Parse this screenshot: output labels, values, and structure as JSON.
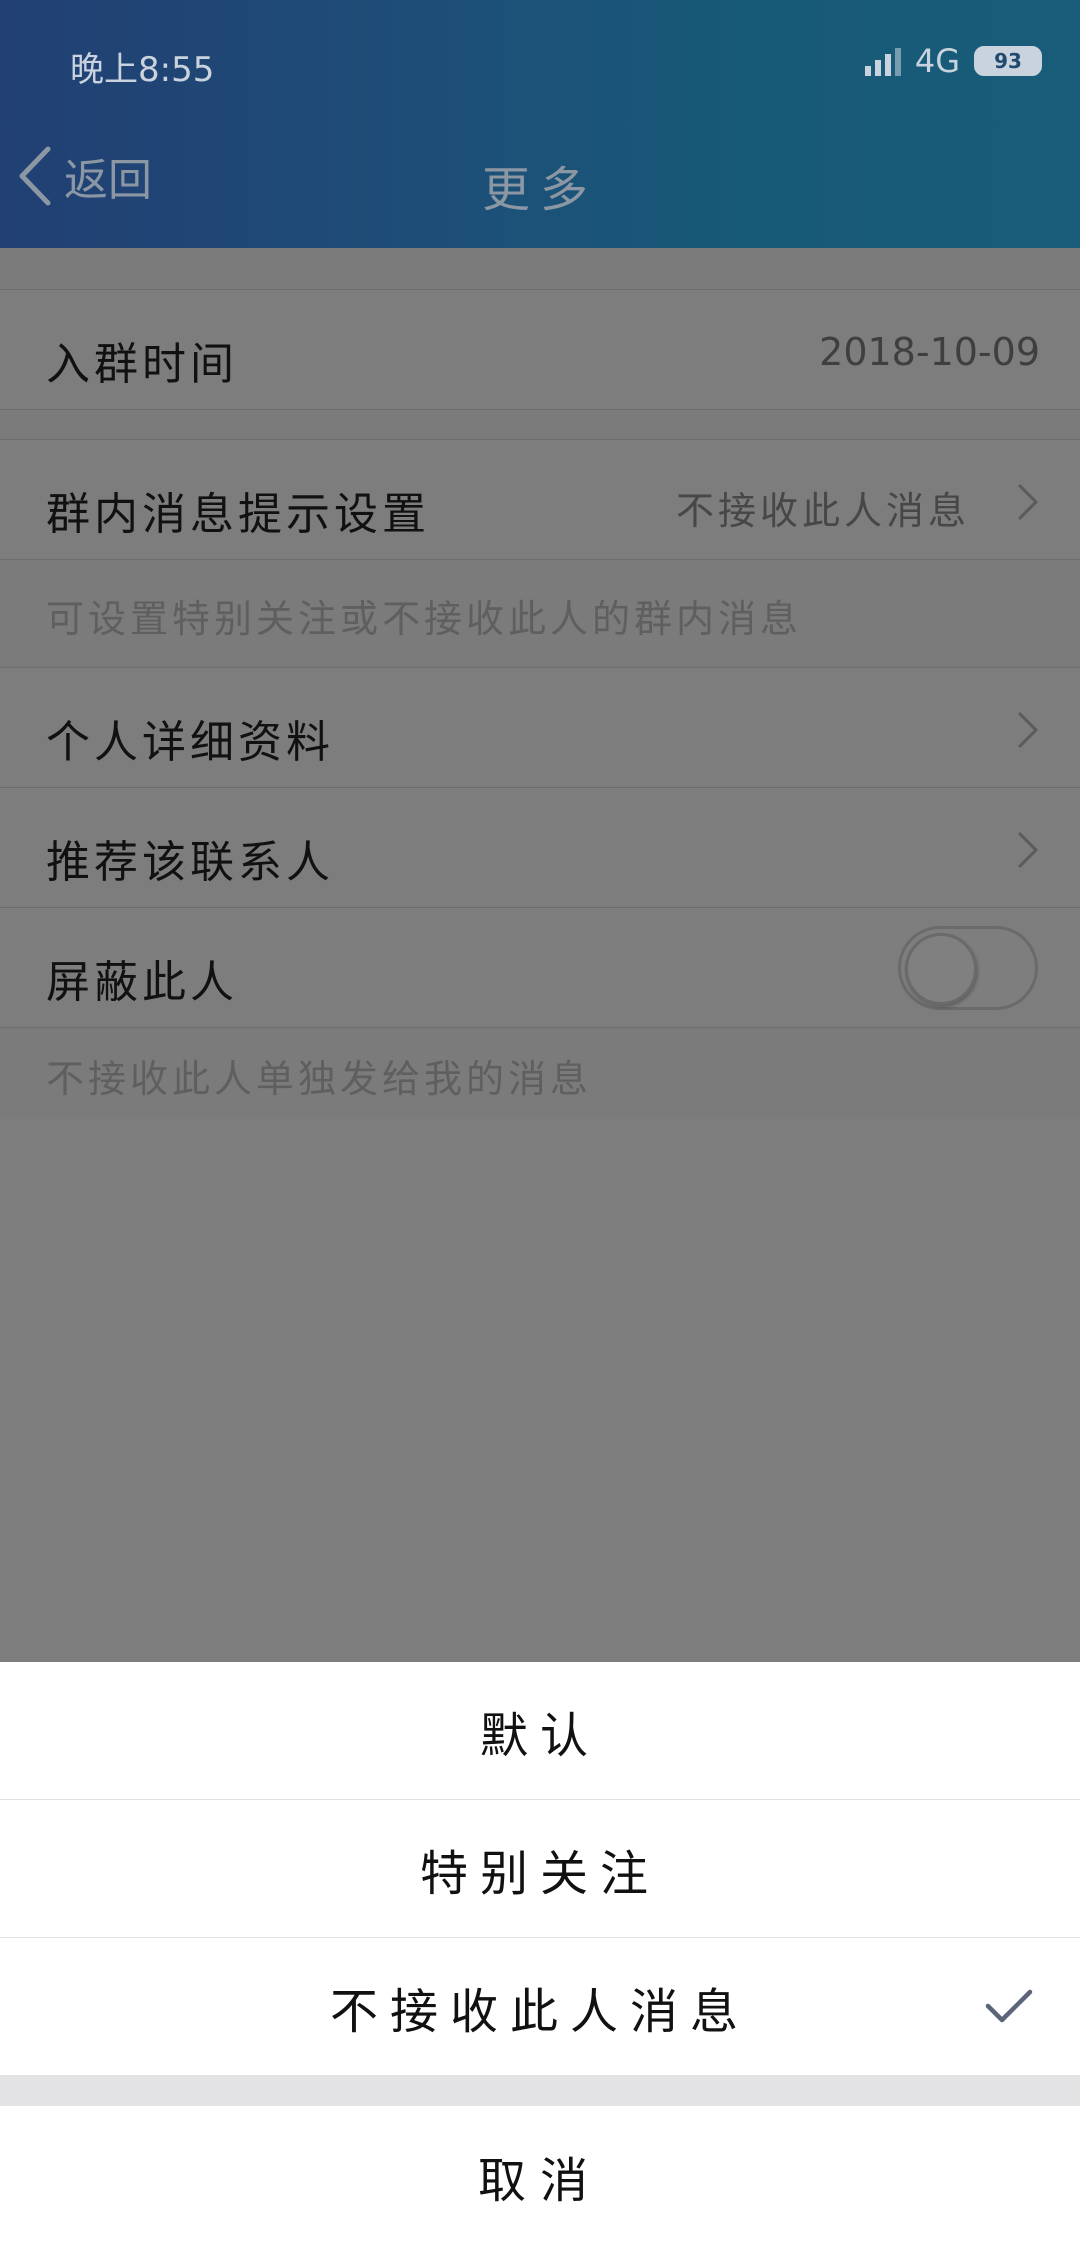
{
  "status_bar": {
    "time": "晚上8:55",
    "network": "4G",
    "battery": "93"
  },
  "nav": {
    "back_label": "返回",
    "title": "更多"
  },
  "rows": {
    "join_time": {
      "label": "入群时间",
      "value": "2018-10-09"
    },
    "msg_setting": {
      "label": "群内消息提示设置",
      "value": "不接收此人消息"
    },
    "msg_hint": "可设置特别关注或不接收此人的群内消息",
    "profile": {
      "label": "个人详细资料"
    },
    "recommend": {
      "label": "推荐该联系人"
    },
    "block": {
      "label": "屏蔽此人",
      "enabled": false
    },
    "block_hint": "不接收此人单独发给我的消息"
  },
  "sheet": {
    "options": [
      "默认",
      "特别关注",
      "不接收此人消息"
    ],
    "selected_index": 2,
    "cancel": "取消"
  },
  "colors": {
    "header_start": "#213f73",
    "header_end": "#195c7a",
    "check": "#5b6478"
  },
  "icons": [
    "chevron-left-icon",
    "chevron-right-icon",
    "checkmark-icon",
    "signal-icon",
    "battery-icon"
  ]
}
